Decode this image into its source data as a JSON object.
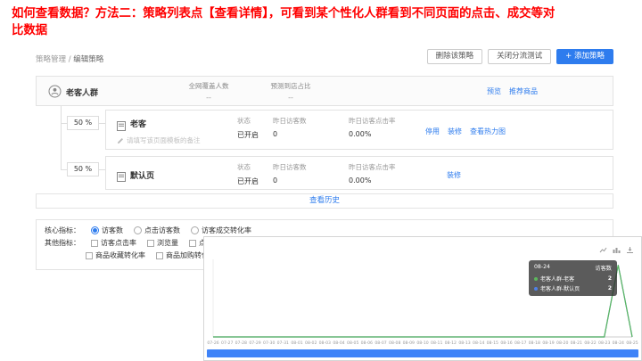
{
  "title": "如何查看数据？方法二：策略列表点【查看详情】，可看到某个性化人群看到不同页面的点击、成交等对比数据",
  "colors": {
    "title_red": "#ff0000",
    "accent": "#2e7cee",
    "series_green": "#5cb85c",
    "series_blue": "#4f81e8",
    "datazoom_blue": "#3f83f8"
  },
  "breadcrumb": {
    "section": "策略管理",
    "separator": "/",
    "current": "编辑策略"
  },
  "toolbar": {
    "delete_label": "删除该策略",
    "close_test_label": "关闭分流测试",
    "add_label": "+ 添加策略"
  },
  "group": {
    "name": "老客人群",
    "cols": [
      {
        "label": "全网覆盖人数",
        "value": "--"
      },
      {
        "label": "预测到店占比",
        "value": "--"
      }
    ],
    "links": [
      "预览",
      "推荐商品"
    ]
  },
  "rows": [
    {
      "percent": "50 %",
      "name": "老客",
      "note": "请填写该页面模板的备注",
      "stats": [
        {
          "label": "状态",
          "value": "已开启"
        },
        {
          "label": "昨日访客数",
          "value": "0"
        },
        {
          "label": "昨日访客点击率",
          "value": "0.00%"
        }
      ],
      "actions": [
        "停用",
        "装修",
        "查看热力图"
      ]
    },
    {
      "percent": "50 %",
      "name": "默认页",
      "stats": [
        {
          "label": "状态",
          "value": "已开启"
        },
        {
          "label": "昨日访客数",
          "value": "0"
        },
        {
          "label": "昨日访客点击率",
          "value": "0.00%"
        }
      ],
      "actions": [
        "装修"
      ]
    }
  ],
  "history_label": "查看历史",
  "metrics": {
    "core_label": "核心指标：",
    "core_options": [
      {
        "label": "访客数",
        "selected": true
      },
      {
        "label": "点击访客数",
        "selected": false
      },
      {
        "label": "访客成交转化率",
        "selected": false
      }
    ],
    "other_label": "其他指标：",
    "other_options_row1": [
      {
        "label": "访客点击率",
        "checked": false
      },
      {
        "label": "浏览量",
        "checked": false
      },
      {
        "label": "点击浏览量",
        "checked": false
      }
    ],
    "other_options_row2": [
      {
        "label": "商品收藏转化率",
        "checked": false
      },
      {
        "label": "商品加购转化率",
        "checked": false
      }
    ]
  },
  "chart_data": {
    "type": "line",
    "title": "",
    "xlabel": "",
    "ylabel": "",
    "ylim": [
      0,
      2
    ],
    "grid": false,
    "legend_position": "none",
    "x": [
      "07-26",
      "07-27",
      "07-28",
      "07-29",
      "07-30",
      "07-31",
      "08-01",
      "08-02",
      "08-03",
      "08-04",
      "08-05",
      "08-06",
      "08-07",
      "08-08",
      "08-09",
      "08-10",
      "08-11",
      "08-12",
      "08-13",
      "08-14",
      "08-15",
      "08-16",
      "08-17",
      "08-18",
      "08-19",
      "08-20",
      "08-21",
      "08-22",
      "08-23",
      "08-24",
      "08-25"
    ],
    "series": [
      {
        "name": "老客人群-老客",
        "color": "#5cb85c",
        "values": [
          0,
          0,
          0,
          0,
          0,
          0,
          0,
          0,
          0,
          0,
          0,
          0,
          0,
          0,
          0,
          0,
          0,
          0,
          0,
          0,
          0,
          0,
          0,
          0,
          0,
          0,
          0,
          0,
          0,
          2,
          0
        ]
      },
      {
        "name": "老客人群-默认页",
        "color": "#4f81e8",
        "values": [
          0,
          0,
          0,
          0,
          0,
          0,
          0,
          0,
          0,
          0,
          0,
          0,
          0,
          0,
          0,
          0,
          0,
          0,
          0,
          0,
          0,
          0,
          0,
          0,
          0,
          0,
          0,
          0,
          0,
          2,
          0
        ]
      }
    ],
    "tooltip": {
      "date": "08-24",
      "metric": "访客数",
      "items": [
        {
          "name": "老客人群-老客",
          "value": "2"
        },
        {
          "name": "老客人群-默认页",
          "value": "2"
        }
      ]
    },
    "datazoom": {
      "selected_range": "full"
    }
  }
}
